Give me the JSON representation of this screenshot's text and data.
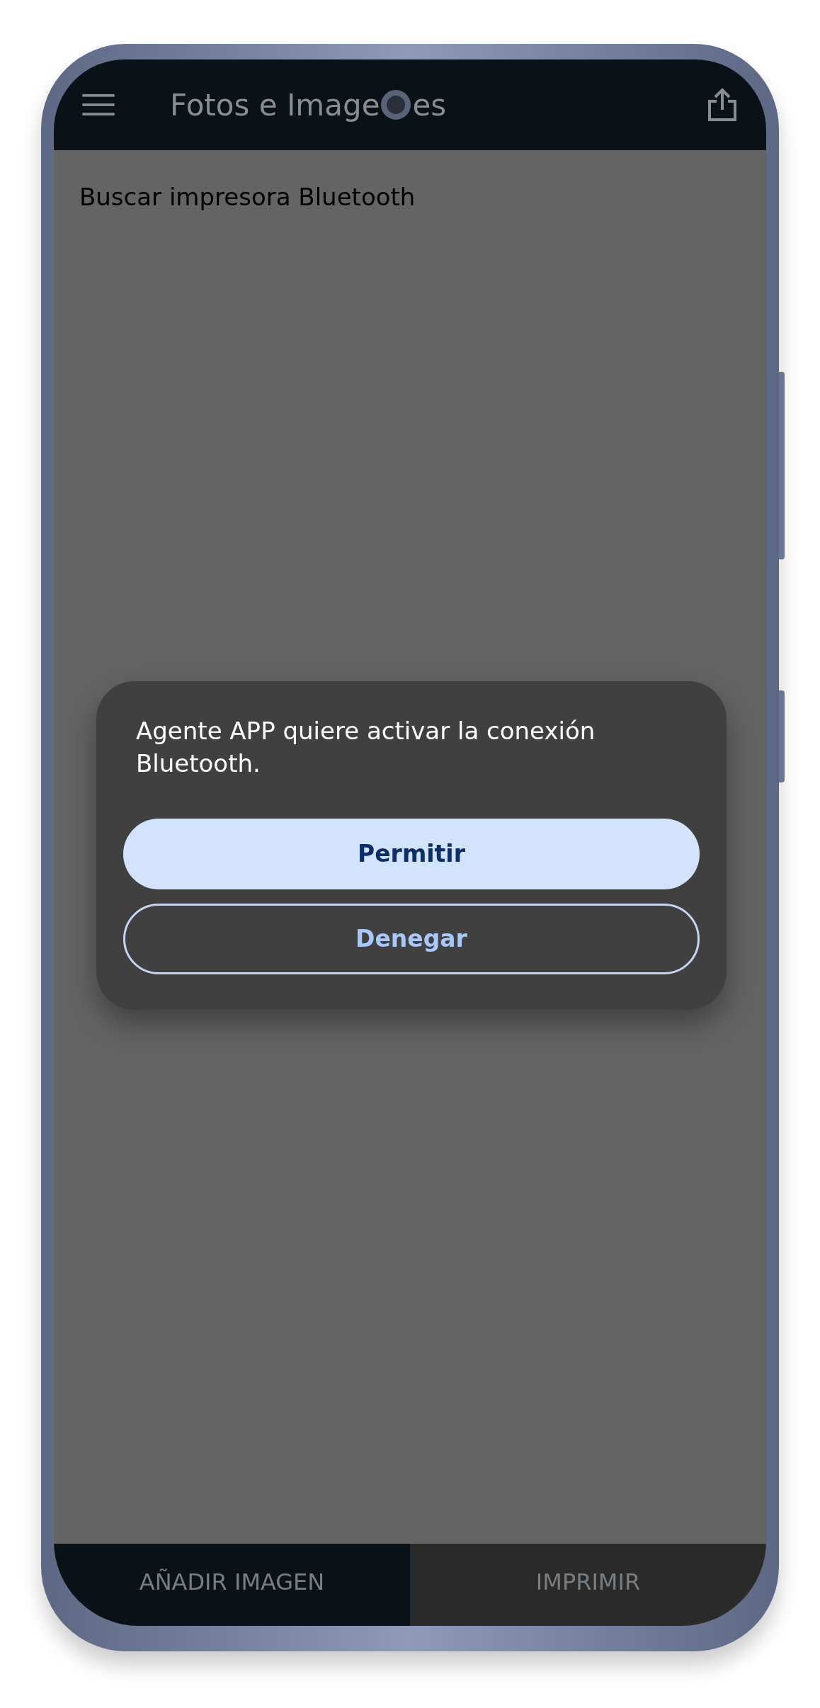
{
  "app_bar": {
    "title_start": "Fotos e Image",
    "title_end": "es"
  },
  "content": {
    "heading": "Buscar impresora Bluetooth"
  },
  "dialog": {
    "message": "Agente APP quiere activar la conexión Bluetooth.",
    "buttons": [
      {
        "label": "Permitir",
        "kind": "filled"
      },
      {
        "label": "Denegar",
        "kind": "outlined"
      }
    ]
  },
  "bottom_bar": [
    {
      "label": "AÑADIR IMAGEN"
    },
    {
      "label": "IMPRIMIR"
    }
  ]
}
